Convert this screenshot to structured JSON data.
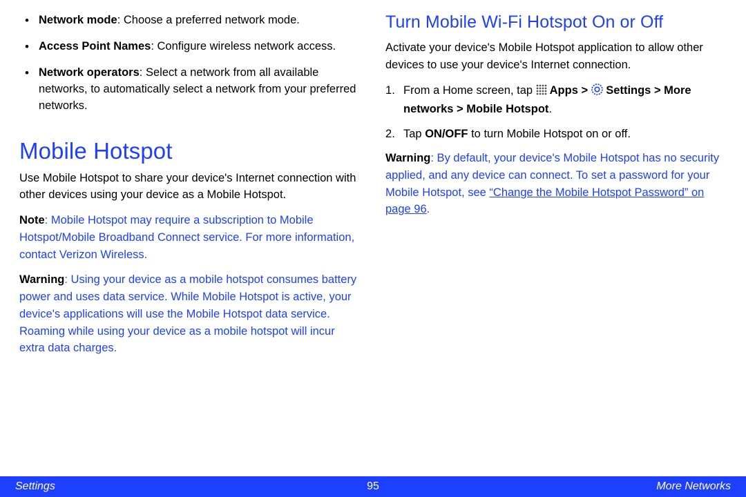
{
  "left": {
    "bullets": [
      {
        "label": "Network mode",
        "desc": ": Choose a preferred network mode."
      },
      {
        "label": "Access Point Names",
        "desc": ": Configure wireless network access."
      },
      {
        "label": "Network operators",
        "desc": ": Select a network from all available networks, to automatically select a network from your preferred networks."
      }
    ],
    "h1": "Mobile Hotspot",
    "intro": "Use Mobile Hotspot to share your device's Internet connection with other devices using your device as a Mobile Hotspot.",
    "note_label": "Note",
    "note_body": ": Mobile Hotspot may require a subscription to Mobile Hotspot/Mobile Broadband Connect service. For more information, contact Verizon Wireless.",
    "warn_label": "Warning",
    "warn_body": ": Using your device as a mobile hotspot consumes battery power and uses data service. While Mobile Hotspot is active, your device's applications will use the Mobile Hotspot data service. Roaming while using your device as a mobile hotspot will incur extra data charges."
  },
  "right": {
    "h2": "Turn Mobile Wi-Fi Hotspot On or Off",
    "intro": "Activate your device's Mobile Hotspot application to allow other devices to use your device's Internet connection.",
    "step1_pre": "From a Home screen, tap ",
    "step1_apps": " Apps > ",
    "step1_settings": " Settings > More networks > Mobile Hotspot",
    "step1_end": ".",
    "step2_pre": "Tap ",
    "step2_bold": "ON/OFF",
    "step2_post": " to turn Mobile Hotspot on or off.",
    "warn_label": "Warning",
    "warn_pre": ": By default, your device's Mobile Hotspot has no security applied, and any device can connect. To set a password for your Mobile Hotspot, see ",
    "warn_link": "“Change the Mobile Hotspot Password” on page 96",
    "warn_post": "."
  },
  "footer": {
    "left": "Settings",
    "center": "95",
    "right": "More Networks"
  }
}
